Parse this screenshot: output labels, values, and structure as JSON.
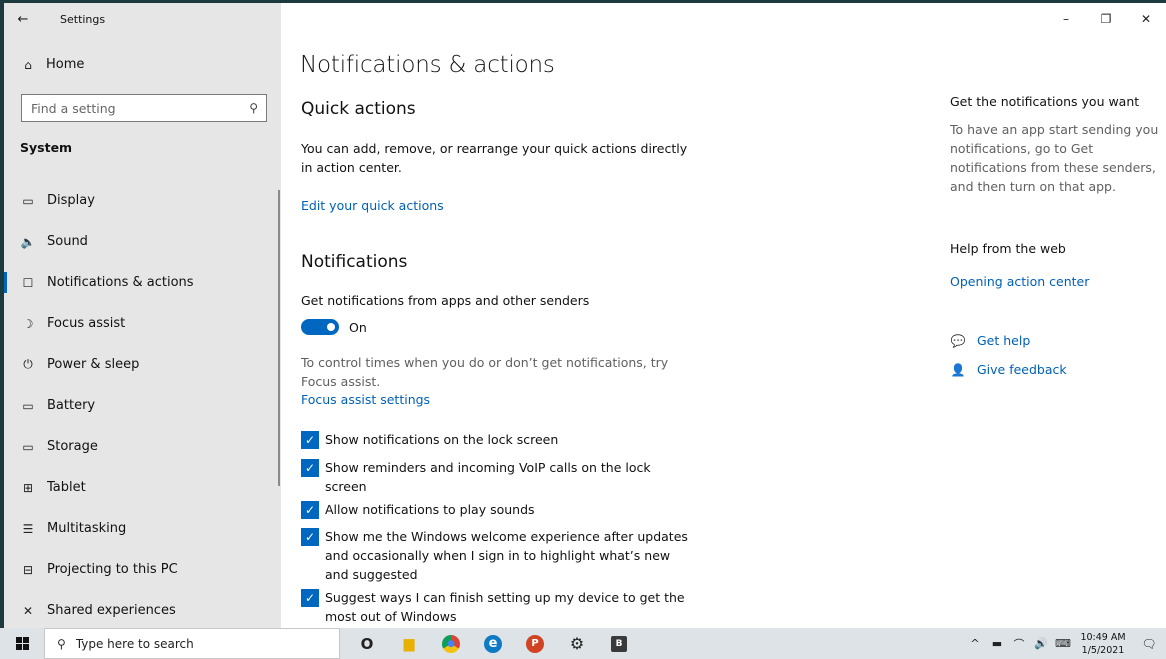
{
  "window": {
    "title": "Settings",
    "back_icon": "←",
    "controls": {
      "minimize": "–",
      "restore": "❐",
      "close": "✕"
    }
  },
  "sidebar": {
    "home_label": "Home",
    "home_icon": "⌂",
    "search_placeholder": "Find a setting",
    "search_icon": "⚲",
    "section_title": "System",
    "items": [
      {
        "label": "Display",
        "icon": "▭"
      },
      {
        "label": "Sound",
        "icon": "🔈"
      },
      {
        "label": "Notifications & actions",
        "icon": "☐"
      },
      {
        "label": "Focus assist",
        "icon": "☽"
      },
      {
        "label": "Power & sleep",
        "icon": "⏻"
      },
      {
        "label": "Battery",
        "icon": "▭"
      },
      {
        "label": "Storage",
        "icon": "▭"
      },
      {
        "label": "Tablet",
        "icon": "⊞"
      },
      {
        "label": "Multitasking",
        "icon": "☰"
      },
      {
        "label": "Projecting to this PC",
        "icon": "⊟"
      },
      {
        "label": "Shared experiences",
        "icon": "✕"
      }
    ],
    "active_index": 2
  },
  "main": {
    "page_title": "Notifications & actions",
    "quick_actions": {
      "heading": "Quick actions",
      "description": "You can add, remove, or rearrange your quick actions directly in action center.",
      "link": "Edit your quick actions"
    },
    "notifications": {
      "heading": "Notifications",
      "toggle_caption": "Get notifications from apps and other senders",
      "toggle_state": "On",
      "focus_text": "To control times when you do or don’t get notifications, try Focus assist.",
      "focus_link": "Focus assist settings",
      "checkboxes": [
        {
          "label": "Show notifications on the lock screen",
          "checked": true
        },
        {
          "label": "Show reminders and incoming VoIP calls on the lock screen",
          "checked": true
        },
        {
          "label": "Allow notifications to play sounds",
          "checked": true
        },
        {
          "label": "Show me the Windows welcome experience after updates and occasionally when I sign in to highlight what’s new and suggested",
          "checked": true
        },
        {
          "label": "Suggest ways I can finish setting up my device to get the most out of Windows",
          "checked": true
        }
      ],
      "check_glyph": "✓"
    }
  },
  "right_panel": {
    "heading1": "Get the notifications you want",
    "text1": "To have an app start sending you notifications, go to Get notifications from these senders, and then turn on that app.",
    "heading2": "Help from the web",
    "link_web": "Opening action center",
    "get_help": "Get help",
    "get_help_icon": "💬",
    "give_feedback": "Give feedback",
    "feedback_icon": "👤"
  },
  "taskbar": {
    "search_placeholder": "Type here to search",
    "search_icon": "⚲",
    "apps": [
      {
        "name": "cortana",
        "glyph": "O",
        "color": "#222222"
      },
      {
        "name": "file-explorer",
        "glyph": "▆",
        "color": "#e8b100"
      },
      {
        "name": "chrome",
        "glyph": "●",
        "color": "#e33b2e"
      },
      {
        "name": "edge",
        "glyph": "e",
        "color": "#0f7ac4"
      },
      {
        "name": "powerpoint",
        "glyph": "P",
        "color": "#d04423"
      },
      {
        "name": "settings",
        "glyph": "⚙",
        "color": "#222222"
      },
      {
        "name": "app-b",
        "glyph": "B",
        "color": "#3a3a3a"
      }
    ],
    "tray_icons": [
      "^",
      "▬",
      "⌒",
      "🔊",
      "⌨"
    ],
    "time": "10:49 AM",
    "date": "1/5/2021",
    "notification_icon": "🗨"
  }
}
